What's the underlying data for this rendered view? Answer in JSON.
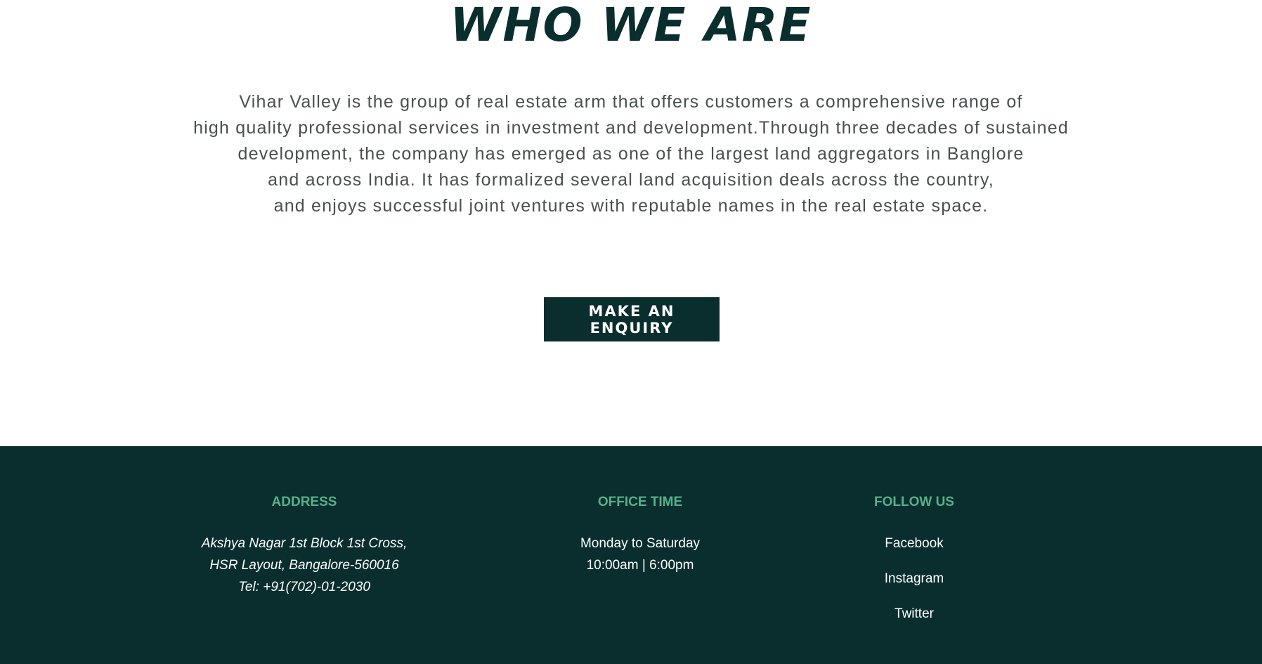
{
  "about": {
    "title": "WHO WE ARE",
    "paragraph_lines": [
      "Vihar Valley is the group of real estate arm that offers customers a comprehensive range of",
      "high quality professional services in investment and development.Through three decades of sustained",
      "development, the company has emerged as one of the largest land aggregators in Banglore",
      "and across India. It has formalized several land acquisition deals across the country,",
      "and enjoys successful joint ventures with reputable names in the real estate space."
    ],
    "enquiry_button_label": "MAKE AN ENQUIRY"
  },
  "footer": {
    "address": {
      "heading": "ADDRESS",
      "lines": [
        "Akshya Nagar 1st Block 1st Cross,",
        "HSR Layout, Bangalore-560016",
        "Tel: +91(702)-01-2030"
      ]
    },
    "office_time": {
      "heading": "OFFICE TIME",
      "lines": [
        "Monday to Saturday",
        "10:00am | 6:00pm"
      ]
    },
    "follow_us": {
      "heading": "FOLLOW US",
      "links": [
        "Facebook",
        "Instagram",
        "Twitter"
      ]
    }
  },
  "colors": {
    "primary_dark": "#0a2e2e",
    "accent_green": "#56b08a",
    "body_text": "#4a4f4f"
  }
}
